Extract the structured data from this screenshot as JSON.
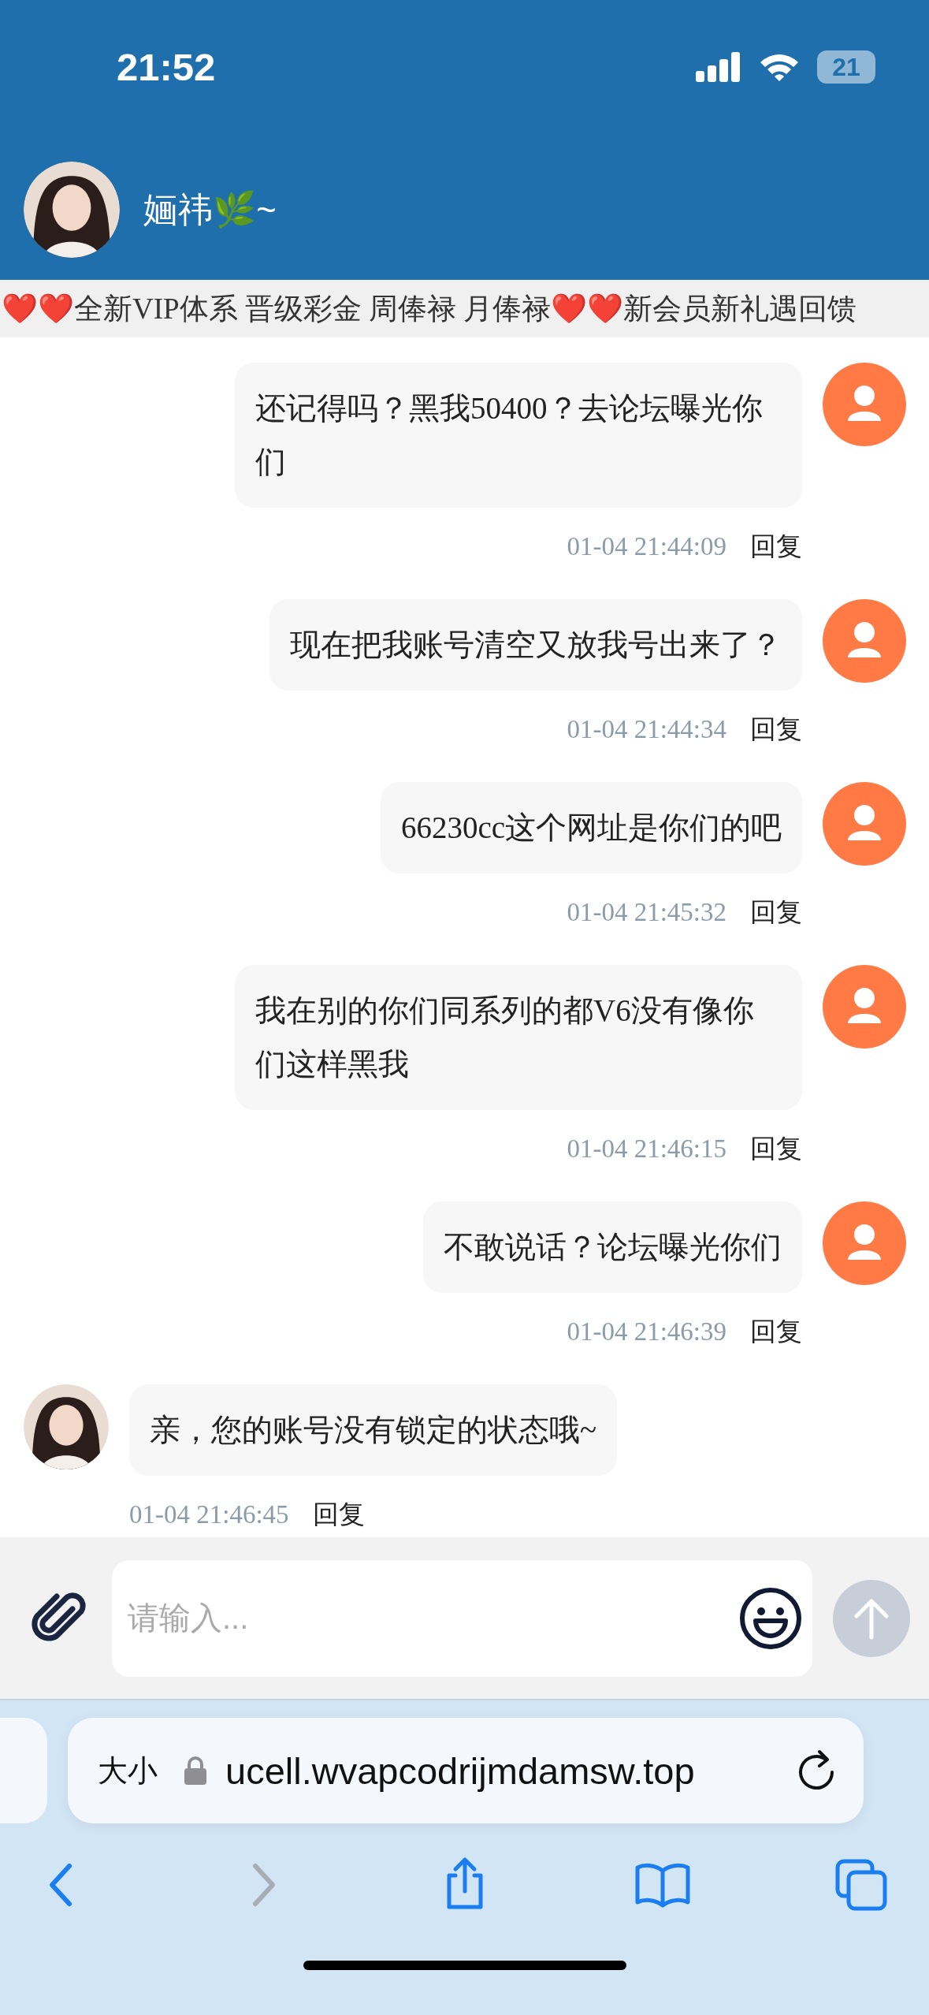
{
  "status_bar": {
    "time": "21:52",
    "battery": "21"
  },
  "header": {
    "contact_name": "婳祎🌿~"
  },
  "marquee": {
    "text": "❤️❤️全新VIP体系 晋级彩金 周俸禄 月俸禄❤️❤️新会员新礼遇回馈"
  },
  "messages": [
    {
      "kind": "outgoing",
      "text": "还记得吗？黑我50400？去论坛曝光你们",
      "time": "01-04 21:44:09",
      "reply": "回复"
    },
    {
      "kind": "outgoing",
      "text": "现在把我账号清空又放我号出来了？",
      "time": "01-04 21:44:34",
      "reply": "回复"
    },
    {
      "kind": "outgoing",
      "text": "66230cc这个网址是你们的吧",
      "time": "01-04 21:45:32",
      "reply": "回复"
    },
    {
      "kind": "outgoing",
      "text": "我在别的你们同系列的都V6没有像你们这样黑我",
      "time": "01-04 21:46:15",
      "reply": "回复"
    },
    {
      "kind": "outgoing",
      "text": "不敢说话？论坛曝光你们",
      "time": "01-04 21:46:39",
      "reply": "回复"
    },
    {
      "kind": "incoming",
      "text": "亲，您的账号没有锁定的状态哦~",
      "time": "01-04 21:46:45",
      "reply": "回复"
    }
  ],
  "composer": {
    "placeholder": "请输入...",
    "send_disabled": true
  },
  "browser": {
    "text_size": "大小",
    "url": "ucell.wvapcodrijmdamsw.top",
    "nav": [
      {
        "kind": "back",
        "disabled": false
      },
      {
        "kind": "forward",
        "disabled": true
      },
      {
        "kind": "share",
        "disabled": false
      },
      {
        "kind": "bookmarks",
        "disabled": false
      },
      {
        "kind": "tabs",
        "disabled": false
      }
    ]
  }
}
